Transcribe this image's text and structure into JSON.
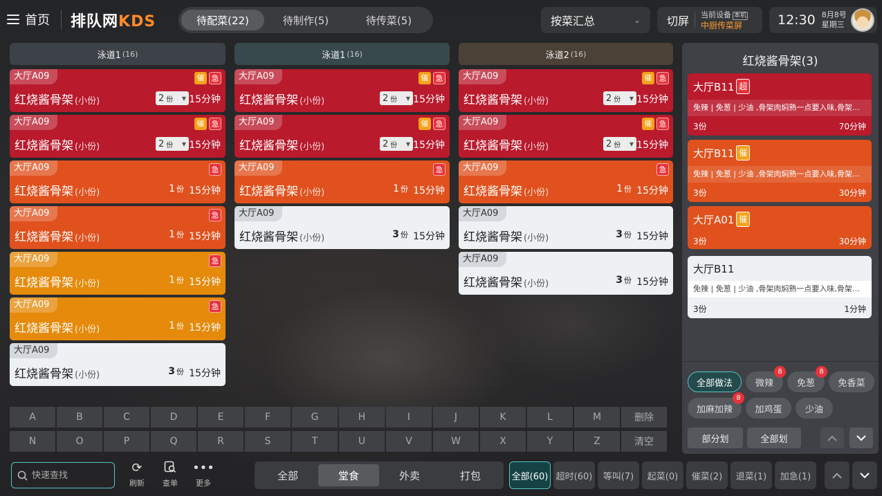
{
  "topbar": {
    "home_label": "首页",
    "logo_text": "排队网",
    "logo_accent": "KDS",
    "status_tabs": [
      {
        "label": "待配菜(22)",
        "active": true
      },
      {
        "label": "待制作(5)",
        "active": false
      },
      {
        "label": "待传菜(5)",
        "active": false
      }
    ],
    "dish_summary_select": "按菜汇总",
    "switch_screen_label": "切屏",
    "current_device_label": "当前设备",
    "device_badge": "本机",
    "device_name": "中厨传菜屏",
    "clock": "12:30",
    "date": "8月8号",
    "weekday": "星期三"
  },
  "lanes": [
    {
      "name": "泳道1",
      "count": "(16)",
      "cards": [
        {
          "table": "大厅A09",
          "dish": "红烧酱骨架",
          "portion": "(小份)",
          "qty": "2",
          "unit": "份",
          "time": "15分钟",
          "color": "red",
          "dropdown": true,
          "flags": [
            "催",
            "急"
          ]
        },
        {
          "table": "大厅A09",
          "dish": "红烧酱骨架",
          "portion": "(小份)",
          "qty": "2",
          "unit": "份",
          "time": "15分钟",
          "color": "red",
          "dropdown": true,
          "flags": [
            "催",
            "急"
          ]
        },
        {
          "table": "大厅A09",
          "dish": "红烧酱骨架",
          "portion": "(小份)",
          "qty": "1",
          "unit": "份",
          "time": "15分钟",
          "color": "orange",
          "dropdown": false,
          "flags": [
            "急"
          ]
        },
        {
          "table": "大厅A09",
          "dish": "红烧酱骨架",
          "portion": "(小份)",
          "qty": "1",
          "unit": "份",
          "time": "15分钟",
          "color": "orange",
          "dropdown": false,
          "flags": [
            "急"
          ]
        },
        {
          "table": "大厅A09",
          "dish": "红烧酱骨架",
          "portion": "(小份)",
          "qty": "1",
          "unit": "份",
          "time": "15分钟",
          "color": "amber",
          "dropdown": false,
          "flags": [
            "急"
          ]
        },
        {
          "table": "大厅A09",
          "dish": "红烧酱骨架",
          "portion": "(小份)",
          "qty": "1",
          "unit": "份",
          "time": "15分钟",
          "color": "amber",
          "dropdown": false,
          "flags": [
            "急"
          ]
        },
        {
          "table": "大厅A09",
          "dish": "红烧酱骨架",
          "portion": "(小份)",
          "qty": "3",
          "unit": "份",
          "time": "15分钟",
          "color": "white",
          "dropdown": false,
          "flags": []
        }
      ]
    },
    {
      "name": "泳道1",
      "count": "(16)",
      "cards": [
        {
          "table": "大厅A09",
          "dish": "红烧酱骨架",
          "portion": "(小份)",
          "qty": "2",
          "unit": "份",
          "time": "15分钟",
          "color": "red",
          "dropdown": true,
          "flags": [
            "催",
            "急"
          ]
        },
        {
          "table": "大厅A09",
          "dish": "红烧酱骨架",
          "portion": "(小份)",
          "qty": "2",
          "unit": "份",
          "time": "15分钟",
          "color": "red",
          "dropdown": true,
          "flags": [
            "催",
            "急"
          ]
        },
        {
          "table": "大厅A09",
          "dish": "红烧酱骨架",
          "portion": "(小份)",
          "qty": "1",
          "unit": "份",
          "time": "15分钟",
          "color": "orange",
          "dropdown": false,
          "flags": [
            "急"
          ]
        },
        {
          "table": "大厅A09",
          "dish": "红烧酱骨架",
          "portion": "(小份)",
          "qty": "3",
          "unit": "份",
          "time": "15分钟",
          "color": "white",
          "dropdown": false,
          "flags": []
        }
      ]
    },
    {
      "name": "泳道2",
      "count": "(16)",
      "cards": [
        {
          "table": "大厅A09",
          "dish": "红烧酱骨架",
          "portion": "(小份)",
          "qty": "2",
          "unit": "份",
          "time": "15分钟",
          "color": "red",
          "dropdown": true,
          "flags": [
            "催",
            "急"
          ]
        },
        {
          "table": "大厅A09",
          "dish": "红烧酱骨架",
          "portion": "(小份)",
          "qty": "2",
          "unit": "份",
          "time": "15分钟",
          "color": "red",
          "dropdown": true,
          "flags": [
            "催",
            "急"
          ]
        },
        {
          "table": "大厅A09",
          "dish": "红烧酱骨架",
          "portion": "(小份)",
          "qty": "1",
          "unit": "份",
          "time": "15分钟",
          "color": "orange",
          "dropdown": false,
          "flags": [
            "急"
          ]
        },
        {
          "table": "大厅A09",
          "dish": "红烧酱骨架",
          "portion": "(小份)",
          "qty": "3",
          "unit": "份",
          "time": "15分钟",
          "color": "white",
          "dropdown": false,
          "flags": []
        },
        {
          "table": "大厅A09",
          "dish": "红烧酱骨架",
          "portion": "(小份)",
          "qty": "3",
          "unit": "份",
          "time": "15分钟",
          "color": "white",
          "dropdown": false,
          "flags": []
        }
      ]
    }
  ],
  "summary": {
    "title": "红烧酱骨架(3)",
    "orders": [
      {
        "table": "大厅B11",
        "flag": "超",
        "note": "免辣 | 免葱 | 少油 ,骨架肉焖熟一点要入味,骨架肉焖熟一点要入味",
        "qty": "3份",
        "time": "70分钟",
        "color": "red"
      },
      {
        "table": "大厅B11",
        "flag": "催",
        "note": "免辣 | 免葱 | 少油 ,骨架肉焖熟一点要入味,骨架肉焖熟一点要入味",
        "qty": "3份",
        "time": "30分钟",
        "color": "orange"
      },
      {
        "table": "大厅A01",
        "flag": "催",
        "note": "",
        "qty": "3份",
        "time": "30分钟",
        "color": "orange"
      },
      {
        "table": "大厅B11",
        "flag": "",
        "note": "免辣 | 免葱 | 少油 ,骨架肉焖熟一点要入味,骨架肉焖熟一点要入味",
        "qty": "3份",
        "time": "1分钟",
        "color": "white"
      }
    ],
    "methods": [
      {
        "label": "全部做法",
        "count": "",
        "active": true
      },
      {
        "label": "微辣",
        "count": "8",
        "active": false
      },
      {
        "label": "免葱",
        "count": "8",
        "active": false
      },
      {
        "label": "免香菜",
        "count": "",
        "active": false
      },
      {
        "label": "加麻加辣",
        "count": "8",
        "active": false
      },
      {
        "label": "加鸡蛋",
        "count": "",
        "active": false
      },
      {
        "label": "少油",
        "count": "",
        "active": false
      }
    ],
    "partial_label": "部分划",
    "all_label": "全部划"
  },
  "keyboard": {
    "row1": [
      "A",
      "B",
      "C",
      "D",
      "E",
      "F",
      "G",
      "H",
      "I",
      "J",
      "K",
      "L",
      "M"
    ],
    "row1_action": "删除",
    "row2": [
      "N",
      "O",
      "P",
      "Q",
      "R",
      "S",
      "T",
      "U",
      "V",
      "W",
      "X",
      "Y",
      "Z"
    ],
    "row2_action": "清空"
  },
  "bottom": {
    "search_placeholder": "快速查找",
    "refresh_label": "刷新",
    "lookup_label": "查单",
    "more_label": "更多",
    "order_types": [
      {
        "label": "全部",
        "active": false
      },
      {
        "label": "堂食",
        "active": true
      },
      {
        "label": "外卖",
        "active": false
      },
      {
        "label": "打包",
        "active": false
      }
    ],
    "filters": [
      "全部(60)",
      "超时(60)",
      "等叫(7)",
      "起菜(0)",
      "催菜(2)",
      "退菜(1)",
      "加急(1)"
    ]
  },
  "colors": {
    "red": "#b91a2c",
    "orange": "#e0511e",
    "amber": "#e58a0b",
    "white": "#eef1f3",
    "accent_teal": "#58c2c5",
    "logo_orange": "#ff8a2a"
  }
}
